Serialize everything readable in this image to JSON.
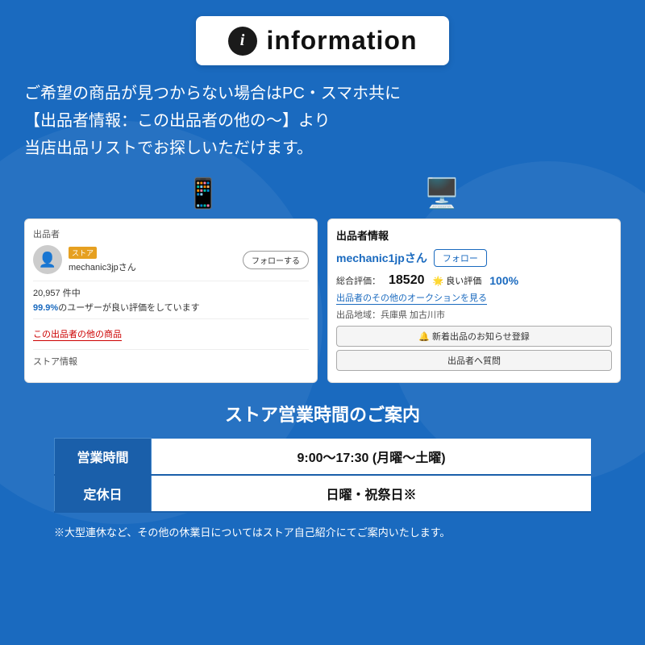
{
  "header": {
    "icon_label": "i",
    "title": "information"
  },
  "description": {
    "line1": "ご希望の商品が見つからない場合はPC・スマホ共に",
    "line2": "【出品者情報：この出品者の他の〜】より",
    "line3": "当店出品リストでお探しいただけます。"
  },
  "left_screenshot": {
    "label": "出品者",
    "store_badge": "ストア",
    "seller_name": "mechanic3jpさん",
    "follow_label": "フォローする",
    "count": "20,957 件中",
    "rating_text": "99.9%のユーザーが良い評価をしています",
    "link_text": "この出品者の他の商品",
    "store_info": "ストア情報"
  },
  "right_screenshot": {
    "header": "出品者情報",
    "seller_name": "mechanic1jpさん",
    "follow_label": "フォロー",
    "total_label": "総合評価：",
    "total_value": "18520",
    "good_label": "🌟 良い評価",
    "good_pct": "100%",
    "auction_link": "出品者のその他のオークションを見る",
    "location_label": "出品地域：兵庫県 加古川市",
    "notify_btn": "🔔 新着出品のお知らせ登録",
    "question_btn": "出品者へ質問"
  },
  "store_hours": {
    "title": "ストア営業時間のご案内",
    "rows": [
      {
        "label": "営業時間",
        "value": "9:00〜17:30 (月曜〜土曜)"
      },
      {
        "label": "定休日",
        "value": "日曜・祝祭日※"
      }
    ],
    "footer": "※大型連休など、その他の休業日についてはストア自己紹介にてご案内いたします。"
  },
  "icons": {
    "mobile": "📱",
    "pc": "🖥️"
  }
}
